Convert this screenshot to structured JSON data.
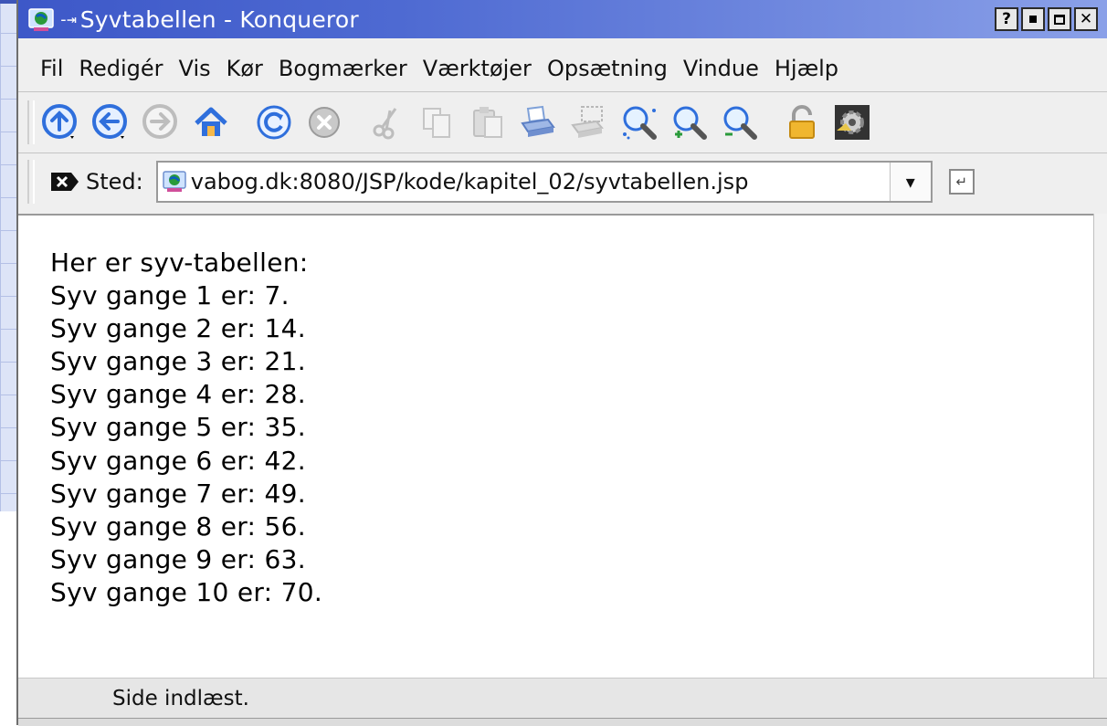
{
  "window": {
    "title": "Syvtabellen - Konqueror",
    "buttons": {
      "help": "?",
      "minimize": "▪",
      "maximize": "◻",
      "close": "✕"
    }
  },
  "menu": [
    "Fil",
    "Redigér",
    "Vis",
    "Kør",
    "Bogmærker",
    "Værktøjer",
    "Opsætning",
    "Vindue",
    "Hjælp"
  ],
  "location": {
    "label": "Sted:",
    "url": "vabog.dk:8080/JSP/kode/kapitel_02/syvtabellen.jsp",
    "dropdown": "▾"
  },
  "content": {
    "heading": "Her er syv-tabellen:",
    "lines": [
      "Syv gange 1 er: 7.",
      "Syv gange 2 er: 14.",
      "Syv gange 3 er: 21.",
      "Syv gange 4 er: 28.",
      "Syv gange 5 er: 35.",
      "Syv gange 6 er: 42.",
      "Syv gange 7 er: 49.",
      "Syv gange 8 er: 56.",
      "Syv gange 9 er: 63.",
      "Syv gange 10 er: 70."
    ]
  },
  "status": "Side indlæst.",
  "toolbar_icons": [
    "up-arrow-icon",
    "back-arrow-icon",
    "forward-arrow-icon",
    "home-icon",
    "reload-icon",
    "stop-icon",
    "cut-icon",
    "copy-icon",
    "paste-icon",
    "print-icon",
    "print-frame-icon",
    "zoom-icon",
    "zoom-in-icon",
    "zoom-out-icon",
    "lock-icon",
    "konqueror-gear-icon"
  ],
  "colors": {
    "titlebar": "#3d58c8",
    "accent": "#2f6fdc"
  }
}
